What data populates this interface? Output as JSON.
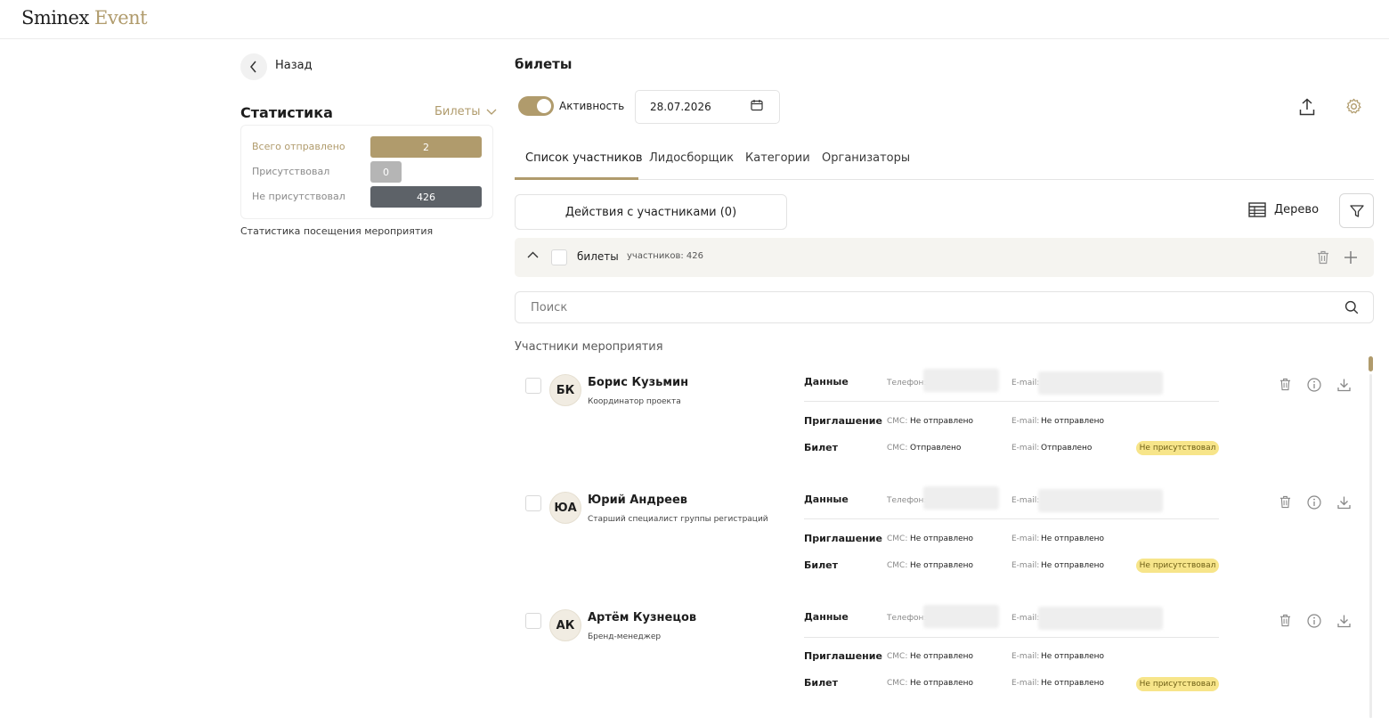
{
  "app": {
    "logo_main": "Sminex",
    "logo_accent": "Event"
  },
  "nav": {
    "back_label": "Назад"
  },
  "stats": {
    "title": "Статистика",
    "select_value": "Билеты",
    "rows": [
      {
        "label": "Всего отправлено",
        "value": "2",
        "color": "#b09b6c"
      },
      {
        "label": "Присутствовал",
        "value": "0",
        "color": "#b5b5b5"
      },
      {
        "label": "Не присутствовал",
        "value": "426",
        "color": "#5d6268"
      }
    ],
    "note": "Статистика посещения мероприятия"
  },
  "main": {
    "title": "билеты",
    "activity_label": "Активность",
    "date_value": "28.07.2026",
    "tabs": [
      {
        "label": "Список участников"
      },
      {
        "label": "Лидосборщик"
      },
      {
        "label": "Категории"
      },
      {
        "label": "Организаторы"
      }
    ],
    "actions_label": "Действия с участниками (0)",
    "tree_label": "Дерево",
    "group": {
      "name": "билеты",
      "count": "участников: 426"
    },
    "search_placeholder": "Поиск",
    "participants_title": "Участники мероприятия"
  },
  "labels": {
    "data": "Данные",
    "invitation": "Приглашение",
    "ticket": "Билет",
    "phone_key": "Телефон:",
    "email_key": "E-mail:",
    "sms_key": "СМС:"
  },
  "participants": [
    {
      "initials": "БК",
      "name": "Борис Кузьмин",
      "role": "Координатор проекта",
      "invite_sms": "Не отправлено",
      "invite_email": "Не отправлено",
      "ticket_sms": "Отправлено",
      "ticket_email": "Отправлено",
      "status": "Не присутствовал"
    },
    {
      "initials": "ЮА",
      "name": "Юрий Андреев",
      "role": "Старший специалист группы регистраций",
      "invite_sms": "Не отправлено",
      "invite_email": "Не отправлено",
      "ticket_sms": "Не отправлено",
      "ticket_email": "Не отправлено",
      "status": "Не присутствовал"
    },
    {
      "initials": "АК",
      "name": "Артём Кузнецов",
      "role": "Бренд-менеджер",
      "invite_sms": "Не отправлено",
      "invite_email": "Не отправлено",
      "ticket_sms": "Не отправлено",
      "ticket_email": "Не отправлено",
      "status": "Не присутствовал"
    }
  ],
  "colors": {
    "accent": "#b09b6c",
    "badge": "#f7e58a",
    "dark_bar": "#5d6268"
  }
}
